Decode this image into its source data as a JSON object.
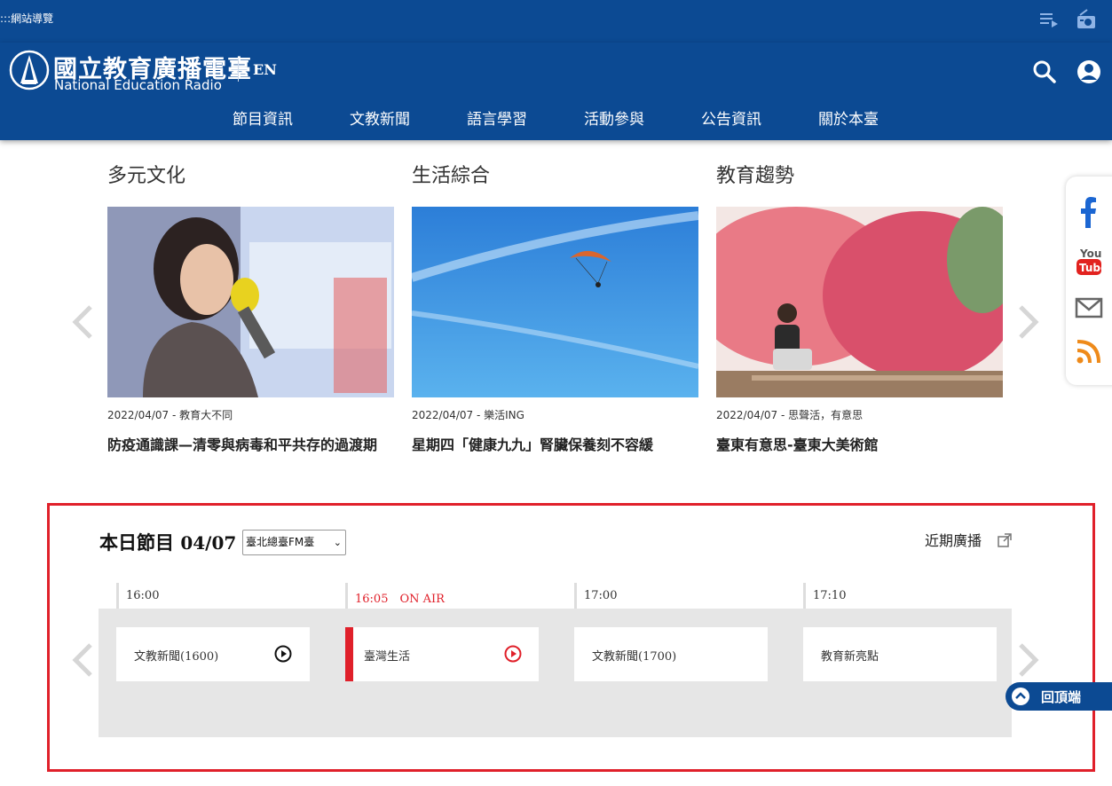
{
  "topbar": {
    "sitemap_label": ":::網站導覽",
    "icons": [
      "playlist-icon",
      "radio-icon"
    ]
  },
  "header": {
    "logo_cn": "國立教育廣播電臺",
    "logo_en": "National Education Radio",
    "lang_label": "EN",
    "icons": [
      "search-icon",
      "user-icon"
    ]
  },
  "nav": {
    "items": [
      "節目資訊",
      "文教新聞",
      "語言學習",
      "活動參與",
      "公告資訊",
      "關於本臺"
    ]
  },
  "cards": [
    {
      "category": "多元文化",
      "meta": "2022/04/07 - 教育大不同",
      "headline": "防疫通識課—清零與病毒和平共存的過渡期",
      "image": "woman-speaking-microphone"
    },
    {
      "category": "生活綜合",
      "meta": "2022/04/07 - 樂活ING",
      "headline": "星期四「健康九九」腎臟保養刻不容緩",
      "image": "paraglider-blue-sky"
    },
    {
      "category": "教育趨勢",
      "meta": "2022/04/07 - 思聲活，有意思",
      "headline": "臺東有意思-臺東大美術館",
      "image": "woman-red-trees"
    }
  ],
  "social": [
    "facebook-icon",
    "youtube-icon",
    "mail-icon",
    "rss-icon"
  ],
  "schedule": {
    "title": "本日節目",
    "date": "04/07",
    "station": "臺北總臺FM臺",
    "recent_label": "近期廣播",
    "slots": [
      {
        "time": "16:00",
        "program": "文教新聞(1600)",
        "live": false
      },
      {
        "time": "16:05　ON AIR",
        "program": "臺灣生活",
        "live": true
      },
      {
        "time": "17:00",
        "program": "文教新聞(1700)",
        "live": false
      },
      {
        "time": "17:10",
        "program": "教育新亮點",
        "live": false
      }
    ]
  },
  "back_to_top": "回頂端",
  "colors": {
    "brand_blue": "#0c4a93",
    "live_red": "#e0202a"
  }
}
